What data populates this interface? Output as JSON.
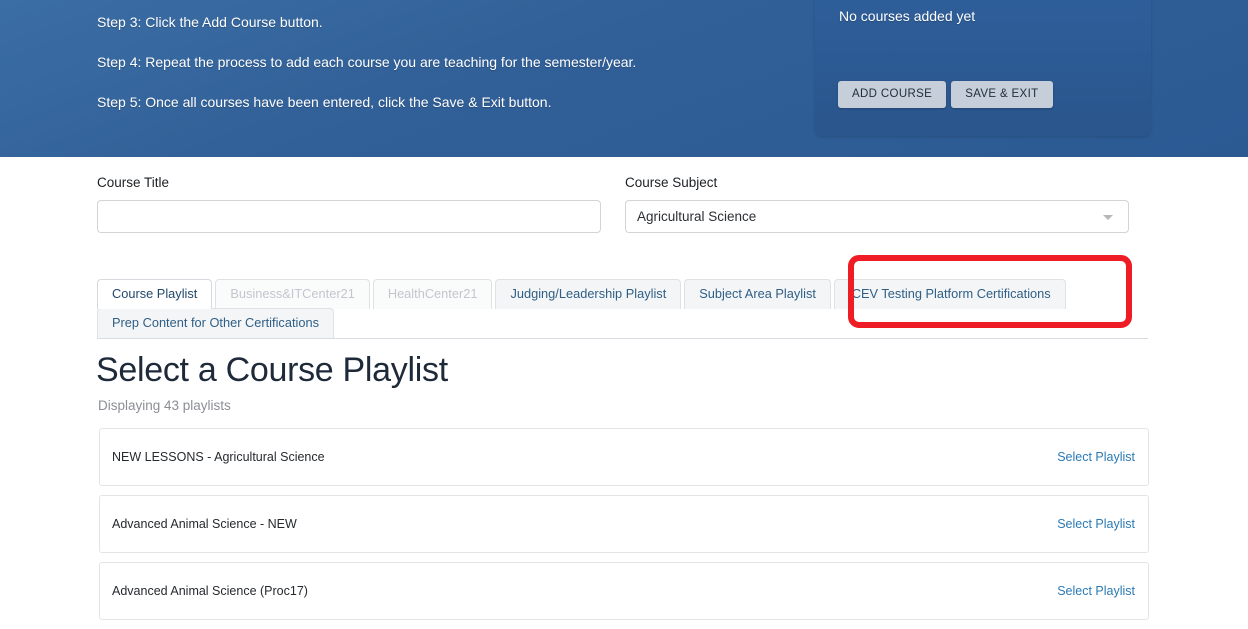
{
  "hero": {
    "steps": [
      "Step 3: Click the Add Course button.",
      "Step 4: Repeat the process to add each course you are teaching for the semester/year.",
      "Step 5: Once all courses have been entered, click the Save & Exit button."
    ],
    "panel": {
      "empty_text": "No courses added yet",
      "add_course_label": "ADD COURSE",
      "save_exit_label": "SAVE & EXIT"
    },
    "background_color": "#315f97"
  },
  "form": {
    "course_title": {
      "label": "Course Title",
      "value": "",
      "placeholder": ""
    },
    "course_subject": {
      "label": "Course Subject",
      "value": "Agricultural Science",
      "caret_icon": "chevron-down-icon"
    }
  },
  "tabs": {
    "row1": [
      {
        "label": "Course Playlist",
        "state": "active"
      },
      {
        "label": "Business&ITCenter21",
        "state": "disabled"
      },
      {
        "label": "HealthCenter21",
        "state": "disabled"
      },
      {
        "label": "Judging/Leadership Playlist",
        "state": "inactive"
      },
      {
        "label": "Subject Area Playlist",
        "state": "inactive"
      },
      {
        "label": "iCEV Testing Platform Certifications",
        "state": "inactive"
      }
    ],
    "row2": [
      {
        "label": "Prep Content for Other Certifications",
        "state": "inactive"
      }
    ]
  },
  "annotation": {
    "highlight_color": "#ee1c25",
    "target": "iCEV Testing Platform Certifications"
  },
  "list": {
    "title": "Select a Course Playlist",
    "subtitle": "Displaying 43 playlists",
    "action_label": "Select Playlist",
    "rows": [
      {
        "name": "NEW LESSONS - Agricultural Science"
      },
      {
        "name": "Advanced Animal Science - NEW"
      },
      {
        "name": "Advanced Animal Science (Proc17)"
      }
    ]
  }
}
